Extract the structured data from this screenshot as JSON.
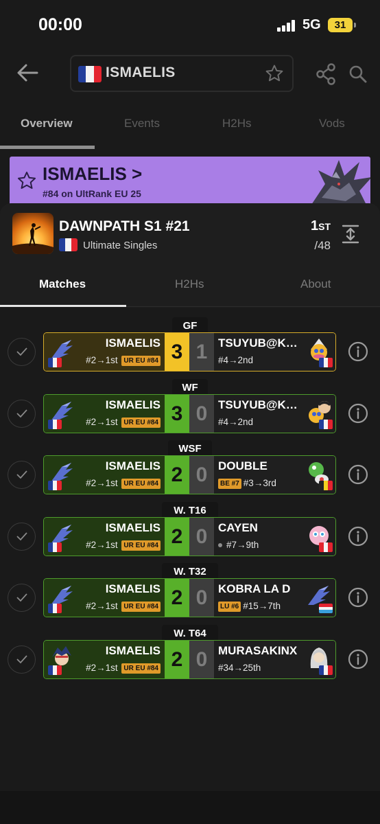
{
  "status": {
    "time": "00:00",
    "network": "5G",
    "battery": "31"
  },
  "header": {
    "player_name": "ISMAELIS"
  },
  "tabs": [
    "Overview",
    "Events",
    "H2Hs",
    "Vods"
  ],
  "banner": {
    "name": "ISMAELIS",
    "chevron": ">",
    "rank_text": "#84 on UltRank EU 25"
  },
  "event": {
    "title": "DAWNPATH S1 #21",
    "subtitle": "Ultimate Singles",
    "placement": "1",
    "placement_suffix": "ST",
    "entrants": "/48"
  },
  "subtabs": [
    "Matches",
    "H2Hs",
    "About"
  ],
  "matches": [
    {
      "round": "GF",
      "p1": "ISMAELIS",
      "p1_info": "#2→1st",
      "p1_badge": "UR EU #84",
      "score1": "3",
      "score2": "1",
      "p2": "TSUYUB@KAON1...",
      "p2_info": "#4→2nd",
      "p2_badge": ""
    },
    {
      "round": "WF",
      "p1": "ISMAELIS",
      "p1_info": "#2→1st",
      "p1_badge": "UR EU #84",
      "score1": "3",
      "score2": "0",
      "p2": "TSUYUB@KAON1...",
      "p2_info": "#4→2nd",
      "p2_badge": ""
    },
    {
      "round": "WSF",
      "p1": "ISMAELIS",
      "p1_info": "#2→1st",
      "p1_badge": "UR EU #84",
      "score1": "2",
      "score2": "0",
      "p2": "DOUBLE",
      "p2_info": "#3→3rd",
      "p2_badge": "BE #7"
    },
    {
      "round": "W. T16",
      "p1": "ISMAELIS",
      "p1_info": "#2→1st",
      "p1_badge": "UR EU #84",
      "score1": "2",
      "score2": "0",
      "p2": "CAYEN",
      "p2_info": "#7→9th",
      "p2_badge": ""
    },
    {
      "round": "W. T32",
      "p1": "ISMAELIS",
      "p1_info": "#2→1st",
      "p1_badge": "UR EU #84",
      "score1": "2",
      "score2": "0",
      "p2": "KOBRA LA D",
      "p2_info": "#15→7th",
      "p2_badge": "LU #6"
    },
    {
      "round": "W. T64",
      "p1": "ISMAELIS",
      "p1_info": "#2→1st",
      "p1_badge": "UR EU #84",
      "score1": "2",
      "score2": "0",
      "p2": "MURASAKINX",
      "p2_info": "#34→25th",
      "p2_badge": ""
    }
  ],
  "colors": {
    "banner": "#a97ee6",
    "win_green": "#58b02a",
    "gf_gold": "#f2c227",
    "badge_orange": "#e09a2a"
  }
}
